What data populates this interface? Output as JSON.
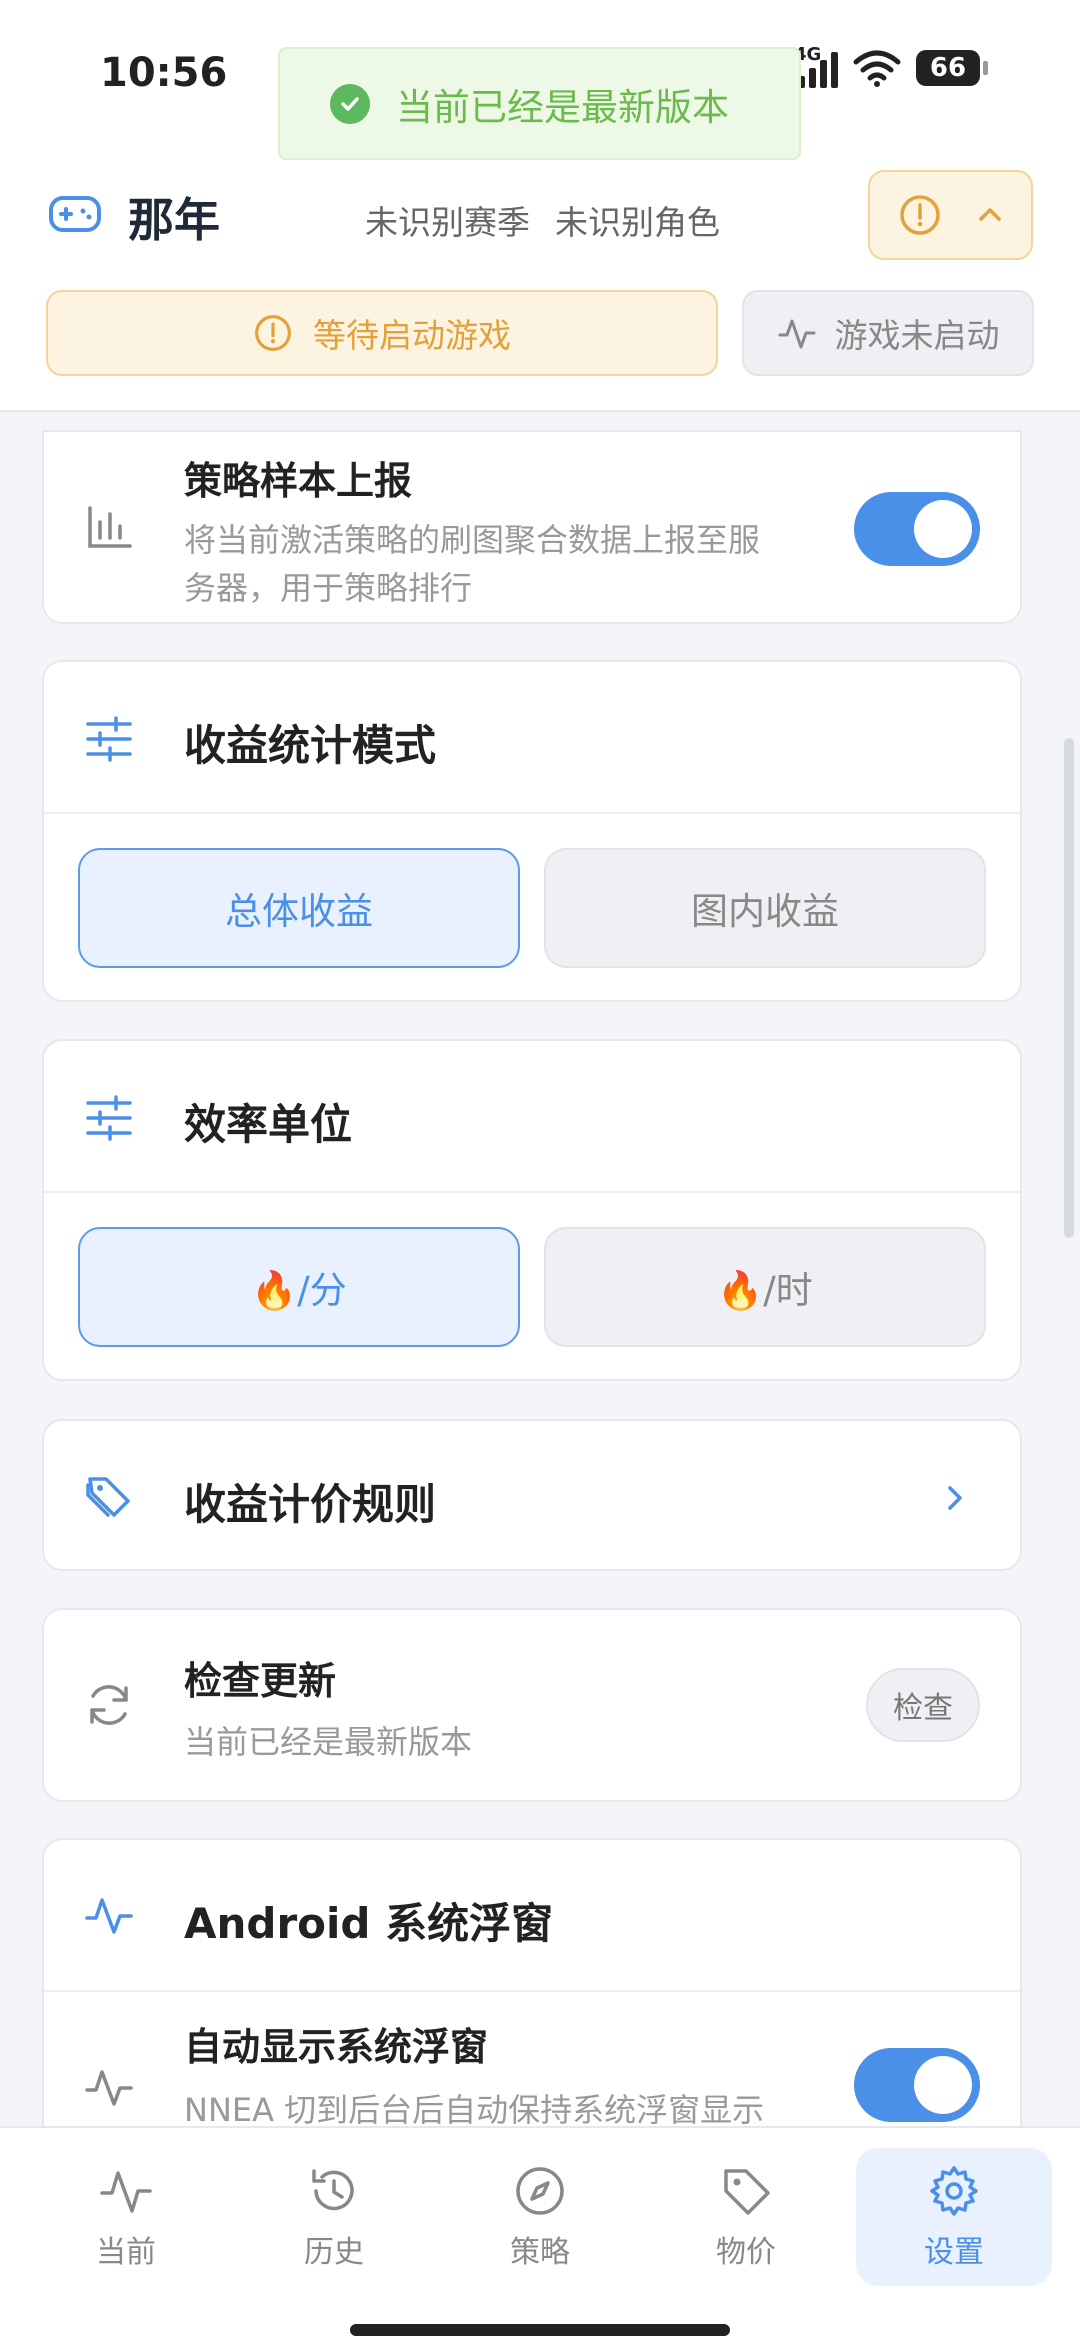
{
  "status_bar": {
    "time": "10:56",
    "signal_1_label": "4G",
    "signal_2_label": "4G",
    "battery": "66"
  },
  "toast": {
    "text": "当前已经是最新版本"
  },
  "header": {
    "app_name": "那年",
    "season": "未识别赛季",
    "role": "未识别角色",
    "wait_label": "等待启动游戏",
    "game_status_label": "游戏未启动"
  },
  "settings": {
    "strategy_report": {
      "title": "策略样本上报",
      "desc_line1": "将当前激活策略的刷图聚合数据上报至服",
      "desc_line2": "务器，用于策略排行",
      "enabled": true
    },
    "income_mode": {
      "title": "收益统计模式",
      "options": [
        "总体收益",
        "图内收益"
      ],
      "selected": "总体收益"
    },
    "efficiency_unit": {
      "title": "效率单位",
      "options": [
        "🔥/分",
        "🔥/时"
      ],
      "selected": "🔥/分"
    },
    "pricing_rules": {
      "title": "收益计价规则"
    },
    "check_update": {
      "title": "检查更新",
      "desc": "当前已经是最新版本",
      "button": "检查"
    },
    "android_overlay": {
      "title": "Android 系统浮窗",
      "auto_show_title": "自动显示系统浮窗",
      "auto_show_desc": "NNEA 切到后台后自动保持系统浮窗显示",
      "enabled": true
    }
  },
  "nav": {
    "items": [
      {
        "label": "当前",
        "icon": "activity-icon"
      },
      {
        "label": "历史",
        "icon": "history-icon"
      },
      {
        "label": "策略",
        "icon": "compass-icon"
      },
      {
        "label": "物价",
        "icon": "tag-icon"
      },
      {
        "label": "设置",
        "icon": "gear-icon"
      }
    ],
    "active": "设置"
  },
  "colors": {
    "accent": "#4a8fe8",
    "warning": "#e3a13a",
    "success": "#5cb85c"
  }
}
